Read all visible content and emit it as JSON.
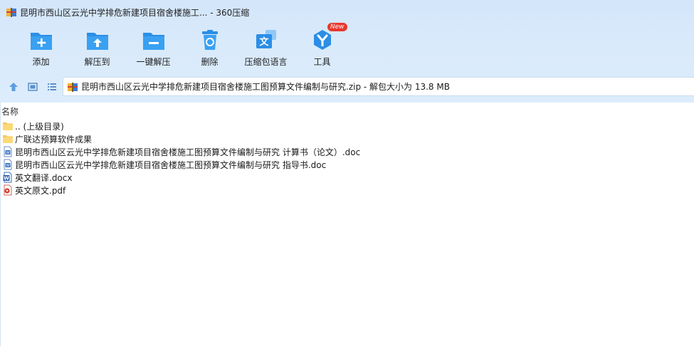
{
  "window": {
    "title": "昆明市西山区云光中学排危新建项目宿舍楼施工... - 360压缩"
  },
  "toolbar": {
    "items": [
      {
        "label": "添加",
        "icon": "add-folder-icon"
      },
      {
        "label": "解压到",
        "icon": "extract-to-icon"
      },
      {
        "label": "一键解压",
        "icon": "one-click-extract-icon"
      },
      {
        "label": "删除",
        "icon": "trash-icon"
      },
      {
        "label": "压缩包语言",
        "icon": "language-icon"
      },
      {
        "label": "工具",
        "icon": "tools-icon",
        "badge": "New"
      }
    ]
  },
  "nav": {
    "address": "昆明市西山区云光中学排危新建项目宿舍楼施工图预算文件编制与研究.zip - 解包大小为 13.8 MB"
  },
  "list": {
    "header": "名称",
    "files": [
      {
        "name": ".. (上级目录)",
        "type": "folder"
      },
      {
        "name": "广联达预算软件成果",
        "type": "folder"
      },
      {
        "name": "昆明市西山区云光中学排危新建项目宿舍楼施工图预算文件编制与研究 计算书（论文）.doc",
        "type": "doc"
      },
      {
        "name": "昆明市西山区云光中学排危新建项目宿舍楼施工图预算文件编制与研究 指导书.doc",
        "type": "doc"
      },
      {
        "name": "英文翻译.docx",
        "type": "docx"
      },
      {
        "name": "英文原文.pdf",
        "type": "pdf"
      }
    ]
  },
  "colors": {
    "chrome_bg": "#d9eafb",
    "icon_blue": "#2b8ee6",
    "badge_red": "#e8372c"
  }
}
